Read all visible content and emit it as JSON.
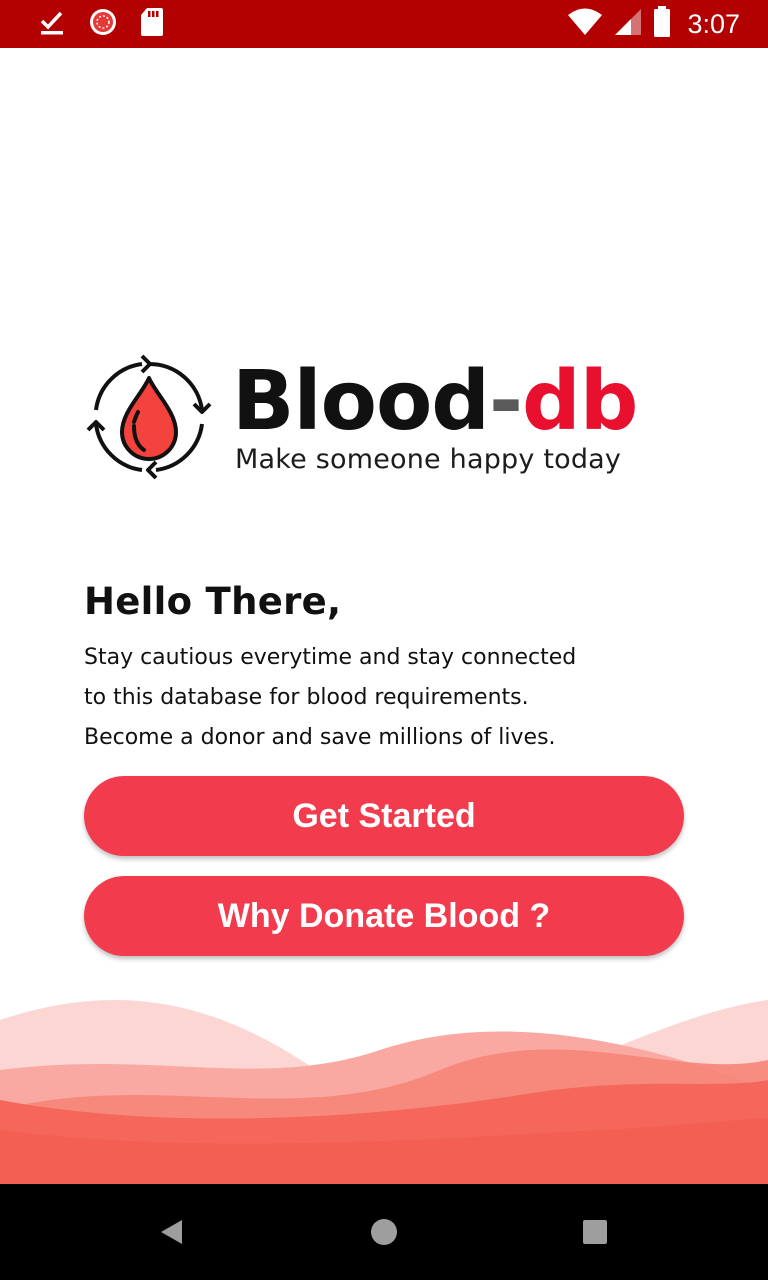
{
  "status_bar": {
    "time": "3:07",
    "background": "#b30000",
    "left_icons": [
      "download-done-icon",
      "app-badge-icon",
      "sd-card-icon"
    ],
    "right_icons": [
      "wifi-icon",
      "cell-signal-icon",
      "battery-icon"
    ]
  },
  "logo": {
    "word_primary": "Blood",
    "word_dash": "-",
    "word_accent": "db",
    "tagline": "Make someone happy today",
    "accent_color": "#e8102e"
  },
  "greeting": "Hello There,",
  "intro": {
    "lines": [
      "Stay cautious everytime and stay connected",
      "to this database for blood requirements.",
      "Become a donor and save millions of lives."
    ]
  },
  "buttons": {
    "get_started": "Get Started",
    "why_donate": "Why Donate Blood ?",
    "color": "#f23b4d"
  },
  "nav_bar": {
    "icons": [
      "back-icon",
      "home-icon",
      "recents-icon"
    ]
  }
}
